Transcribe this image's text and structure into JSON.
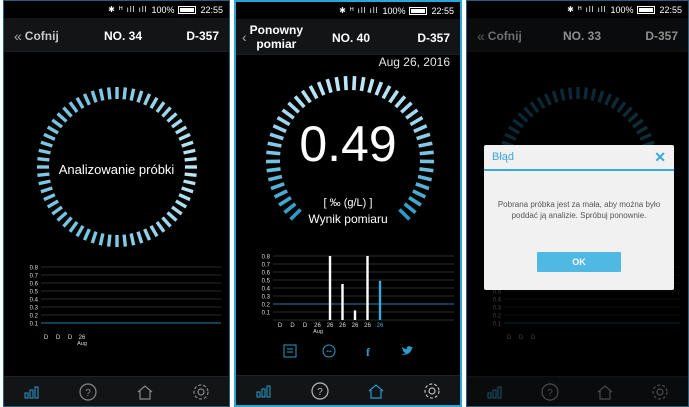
{
  "status_bar": {
    "battery": "100%",
    "time": "22:55"
  },
  "colors": {
    "accent": "#37a9dc",
    "gauge_light": "#bfe6f5",
    "gauge_dark": "#2b9cc9",
    "background": "#000000"
  },
  "screen1": {
    "header": {
      "back_label": "Cofnij",
      "number": "NO. 34",
      "device": "D-357"
    },
    "gauge_text": "Analizowanie próbki",
    "chart": {
      "y_ticks": [
        "0.8",
        "0.7",
        "0.6",
        "0.5",
        "0.4",
        "0.3",
        "0.2",
        "0.1"
      ],
      "x_labels": [
        "D",
        "D",
        "D",
        "26"
      ],
      "month": "Aug"
    }
  },
  "screen2": {
    "header": {
      "back_label_line1": "Ponowny",
      "back_label_line2": "pomiar",
      "number": "NO. 40",
      "device": "D-357"
    },
    "date": "Aug 26, 2016",
    "value": "0.49",
    "unit": "[ ‰ (g/L) ]",
    "caption": "Wynik pomiaru",
    "chart_data": {
      "type": "bar",
      "categories": [
        "D",
        "D",
        "D",
        "26",
        "26",
        "26",
        "26",
        "26",
        "26"
      ],
      "values": [
        0,
        0,
        0,
        0,
        0.8,
        0.45,
        0.12,
        0.8,
        0.49
      ],
      "highlight_index": 8,
      "ylim": [
        0,
        0.8
      ],
      "y_ticks": [
        "0.8",
        "0.7",
        "0.6",
        "0.5",
        "0.4",
        "0.3",
        "0.2",
        "0.1"
      ],
      "month": "Aug"
    },
    "share_icons": [
      "journal-icon",
      "chat-icon",
      "facebook-icon",
      "twitter-icon"
    ]
  },
  "screen3": {
    "header": {
      "back_label": "Cofnij",
      "number": "NO. 33",
      "device": "D-357"
    },
    "chart": {
      "y_ticks": [
        "0.5",
        "0.4",
        "0.3",
        "0.2",
        "0.1"
      ],
      "x_labels": [
        "D",
        "D",
        "D"
      ]
    },
    "dialog": {
      "title": "Błąd",
      "close": "✕",
      "message": "Pobrana próbka jest za mała, aby można było poddać ją analizie. Spróbuj ponownie.",
      "ok_label": "OK"
    }
  },
  "navbar": [
    "chart-icon",
    "help-icon",
    "home-icon",
    "settings-icon"
  ]
}
